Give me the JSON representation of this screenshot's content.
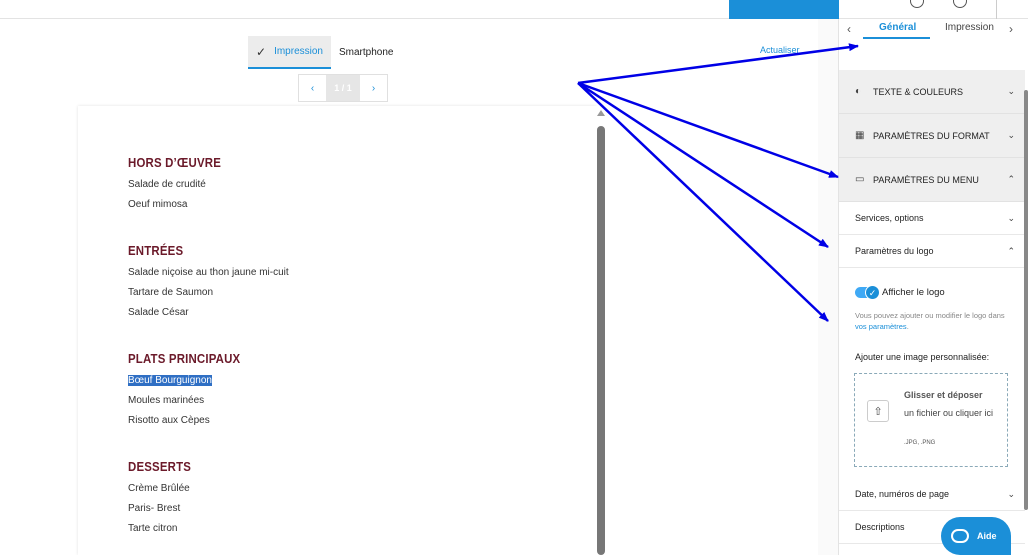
{
  "preview": {
    "mode_tabs": [
      "Impression",
      "Smartphone"
    ],
    "refresh_label": "Actualiser",
    "pager": {
      "prev": "‹",
      "page": "1 / 1",
      "next": "›"
    }
  },
  "menu": {
    "sections": [
      {
        "heading": "HORS D’ŒUVRE",
        "items": [
          "Salade de crudité",
          "Oeuf mimosa"
        ]
      },
      {
        "heading": "ENTRÉES",
        "items": [
          "Salade niçoise au thon jaune mi-cuit",
          "Tartare de Saumon",
          "Salade César"
        ]
      },
      {
        "heading": "PLATS PRINCIPAUX",
        "items": [
          "Bœuf Bourguignon",
          "Moules marinées",
          "Risotto aux Cèpes"
        ]
      },
      {
        "heading": "DESSERTS",
        "items": [
          "Crème Brûlée",
          "Paris- Brest",
          "Tarte citron"
        ]
      }
    ],
    "selected_item": "Bœuf Bourguignon",
    "heading_color": "#6b1a2a"
  },
  "sidebar": {
    "tabs": [
      "Général",
      "Impression"
    ],
    "accordions": [
      {
        "label": "TEXTE & COULEURS",
        "icon": "palette-icon",
        "expanded": false
      },
      {
        "label": "PARAMÈTRES DU FORMAT",
        "icon": "layout-icon",
        "expanded": false
      },
      {
        "label": "PARAMÈTRES DU MENU",
        "icon": "book-icon",
        "expanded": true
      }
    ],
    "subsections": {
      "services": "Services, options",
      "logo": "Paramètres du logo",
      "date": "Date, numéros de page",
      "descriptions": "Descriptions"
    },
    "logo_settings": {
      "toggle_label": "Afficher le logo",
      "toggle_on": true,
      "help_text": "Vous pouvez ajouter ou modifier le logo dans ",
      "help_link": "vos paramètres",
      "help_end": ".",
      "custom_image_label": "Ajouter une image personnalisée:",
      "dropzone_title": "Glisser et déposer",
      "dropzone_sub": "un fichier ou cliquer ici",
      "dropzone_formats": ".JPG, .PNG"
    }
  },
  "help_button": "Aide",
  "colors": {
    "accent": "#1b8fd8",
    "arrows": "#0000e6"
  }
}
